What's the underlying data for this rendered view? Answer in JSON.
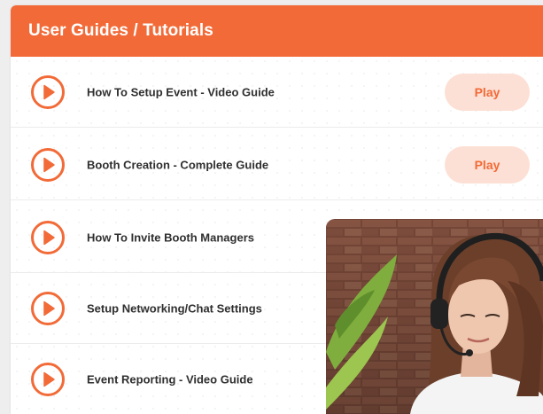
{
  "header": {
    "title": "User Guides / Tutorials"
  },
  "guides": [
    {
      "label": "How To Setup Event - Video Guide",
      "button": "Play"
    },
    {
      "label": "Booth Creation - Complete Guide",
      "button": "Play"
    },
    {
      "label": "How To Invite Booth Managers"
    },
    {
      "label": "Setup Networking/Chat Settings"
    },
    {
      "label": "Event Reporting - Video Guide"
    }
  ],
  "colors": {
    "accent": "#f26a37",
    "button_bg": "#fde0d5",
    "text": "#2f2f2f"
  },
  "icons": {
    "row_icon": "play-circle-icon"
  },
  "image": {
    "subject": "woman-with-headset-photo"
  }
}
